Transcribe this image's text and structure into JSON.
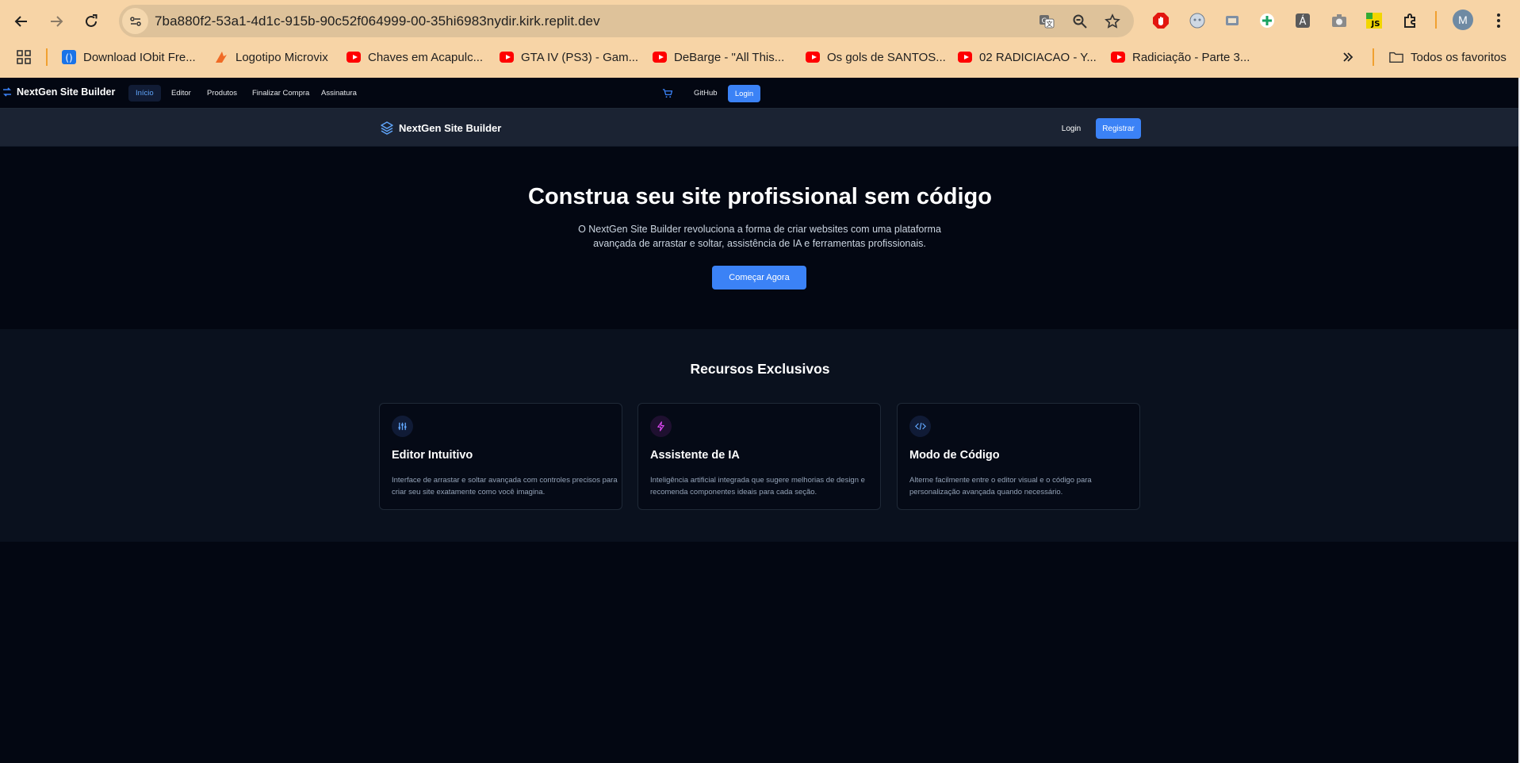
{
  "browser": {
    "url": "7ba880f2-53a1-4d1c-915b-90c52f064999-00-35hi6983nydir.kirk.replit.dev",
    "bookmarks": [
      {
        "label": "Download IObit Fre..."
      },
      {
        "label": "Logotipo Microvix"
      },
      {
        "label": "Chaves em Acapulc..."
      },
      {
        "label": "GTA IV (PS3) - Gam..."
      },
      {
        "label": "DeBarge - \"All This..."
      },
      {
        "label": "Os gols de SANTOS..."
      },
      {
        "label": "02 RADICIACAO - Y..."
      },
      {
        "label": "Radiciação - Parte 3..."
      }
    ],
    "all_bookmarks": "Todos os favoritos",
    "profile_initial": "M",
    "accent": "#f7d4a6"
  },
  "appnav": {
    "brand": "NextGen Site Builder",
    "links": [
      "Início",
      "Editor",
      "Produtos",
      "Finalizar Compra",
      "Assinatura"
    ],
    "github": "GitHub",
    "login": "Login"
  },
  "header": {
    "brand": "NextGen Site Builder",
    "login": "Login",
    "register": "Registrar"
  },
  "hero": {
    "title": "Construa seu site profissional sem código",
    "text": "O NextGen Site Builder revoluciona a forma de criar websites com uma plataforma avançada de arrastar e soltar, assistência de IA e ferramentas profissionais.",
    "cta": "Começar Agora"
  },
  "features": {
    "title": "Recursos Exclusivos",
    "cards": [
      {
        "icon": "sliders-icon",
        "title": "Editor Intuitivo",
        "desc": "Interface de arrastar e soltar avançada com controles precisos para criar seu site exatamente como você imagina."
      },
      {
        "icon": "zap-icon",
        "title": "Assistente de IA",
        "desc": "Inteligência artificial integrada que sugere melhorias de design e recomenda componentes ideais para cada seção."
      },
      {
        "icon": "code-icon",
        "title": "Modo de Código",
        "desc": "Alterne facilmente entre o editor visual e o código para personalização avançada quando necessário."
      }
    ]
  },
  "colors": {
    "primary": "#3b82f6",
    "background": "#030712"
  }
}
